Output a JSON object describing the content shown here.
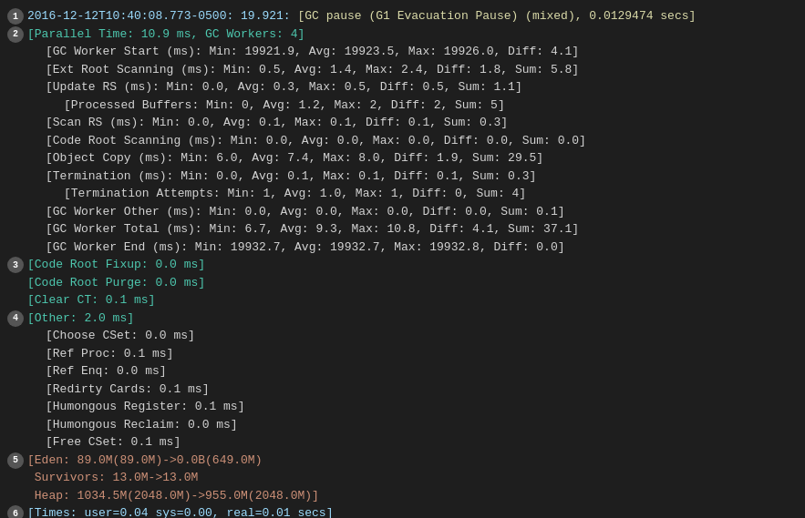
{
  "lines": [
    {
      "number": 1,
      "indent": 0,
      "parts": [
        {
          "text": "2016-12-12T10:40:08.773-0500: 19.921: ",
          "color": "c-cyan"
        },
        {
          "text": "[GC pause (G1 Evacuation Pause) (mixed), 0.0129474 secs]",
          "color": "c-yellow"
        }
      ]
    },
    {
      "number": 2,
      "indent": 0,
      "parts": [
        {
          "text": "[Parallel Time: 10.9 ms, GC Workers: 4]",
          "color": "c-green"
        }
      ]
    },
    {
      "number": null,
      "indent": 1,
      "parts": [
        {
          "text": "[GC Worker Start (ms): Min: 19921.9, Avg: 19923.5, Max: 19926.0, Diff: 4.1]",
          "color": "c-white"
        }
      ]
    },
    {
      "number": null,
      "indent": 1,
      "parts": [
        {
          "text": "[Ext Root Scanning (ms): Min: 0.5, Avg: 1.4, Max: 2.4, Diff: 1.8, Sum: 5.8]",
          "color": "c-white"
        }
      ]
    },
    {
      "number": null,
      "indent": 1,
      "parts": [
        {
          "text": "[Update RS (ms): Min: 0.0, Avg: 0.3, Max: 0.5, Diff: 0.5, Sum: 1.1]",
          "color": "c-white"
        }
      ]
    },
    {
      "number": null,
      "indent": 2,
      "parts": [
        {
          "text": "[Processed Buffers: Min: 0, Avg: 1.2, Max: 2, Diff: 2, Sum: 5]",
          "color": "c-white"
        }
      ]
    },
    {
      "number": null,
      "indent": 1,
      "parts": [
        {
          "text": "[Scan RS (ms): Min: 0.0, Avg: 0.1, Max: 0.1, Diff: 0.1, Sum: 0.3]",
          "color": "c-white"
        }
      ]
    },
    {
      "number": null,
      "indent": 1,
      "parts": [
        {
          "text": "[Code Root Scanning (ms): Min: 0.0, Avg: 0.0, Max: 0.0, Diff: 0.0, Sum: 0.0]",
          "color": "c-white"
        }
      ]
    },
    {
      "number": null,
      "indent": 1,
      "parts": [
        {
          "text": "[Object Copy (ms): Min: 6.0, Avg: 7.4, Max: 8.0, Diff: 1.9, Sum: 29.5]",
          "color": "c-white"
        }
      ]
    },
    {
      "number": null,
      "indent": 1,
      "parts": [
        {
          "text": "[Termination (ms): Min: 0.0, Avg: 0.1, Max: 0.1, Diff: 0.1, Sum: 0.3]",
          "color": "c-white"
        }
      ]
    },
    {
      "number": null,
      "indent": 2,
      "parts": [
        {
          "text": "[Termination Attempts: Min: 1, Avg: 1.0, Max: 1, Diff: 0, Sum: 4]",
          "color": "c-white"
        }
      ]
    },
    {
      "number": null,
      "indent": 1,
      "parts": [
        {
          "text": "[GC Worker Other (ms): Min: 0.0, Avg: 0.0, Max: 0.0, Diff: 0.0, Sum: 0.1]",
          "color": "c-white"
        }
      ]
    },
    {
      "number": null,
      "indent": 1,
      "parts": [
        {
          "text": "[GC Worker Total (ms): Min: 6.7, Avg: 9.3, Max: 10.8, Diff: 4.1, Sum: 37.1]",
          "color": "c-white"
        }
      ]
    },
    {
      "number": null,
      "indent": 1,
      "parts": [
        {
          "text": "[GC Worker End (ms): Min: 19932.7, Avg: 19932.7, Max: 19932.8, Diff: 0.0]",
          "color": "c-white"
        }
      ]
    },
    {
      "number": 3,
      "indent": 0,
      "parts": [
        {
          "text": "[Code Root Fixup: 0.0 ms]",
          "color": "c-green"
        }
      ]
    },
    {
      "number": null,
      "indent": 0,
      "no_number": true,
      "parts": [
        {
          "text": "[Code Root Purge: 0.0 ms]",
          "color": "c-green"
        }
      ]
    },
    {
      "number": null,
      "indent": 0,
      "no_number": true,
      "parts": [
        {
          "text": "[Clear CT: 0.1 ms]",
          "color": "c-green"
        }
      ]
    },
    {
      "number": 4,
      "indent": 0,
      "parts": [
        {
          "text": "[Other: 2.0 ms]",
          "color": "c-green"
        }
      ]
    },
    {
      "number": null,
      "indent": 1,
      "parts": [
        {
          "text": "[Choose CSet: 0.0 ms]",
          "color": "c-white"
        }
      ]
    },
    {
      "number": null,
      "indent": 1,
      "parts": [
        {
          "text": "[Ref Proc: 0.1 ms]",
          "color": "c-white"
        }
      ]
    },
    {
      "number": null,
      "indent": 1,
      "parts": [
        {
          "text": "[Ref Enq: 0.0 ms]",
          "color": "c-white"
        }
      ]
    },
    {
      "number": null,
      "indent": 1,
      "parts": [
        {
          "text": "[Redirty Cards: 0.1 ms]",
          "color": "c-white"
        }
      ]
    },
    {
      "number": null,
      "indent": 1,
      "parts": [
        {
          "text": "[Humongous Register: 0.1 ms]",
          "color": "c-white"
        }
      ]
    },
    {
      "number": null,
      "indent": 1,
      "parts": [
        {
          "text": "[Humongous Reclaim: 0.0 ms]",
          "color": "c-white"
        }
      ]
    },
    {
      "number": null,
      "indent": 1,
      "parts": [
        {
          "text": "[Free CSet: 0.1 ms]",
          "color": "c-white"
        }
      ]
    },
    {
      "number": 5,
      "indent": 0,
      "parts": [
        {
          "text": "[Eden: 89.0M(89.0M)->0.0B(649.0M)",
          "color": "c-orange"
        }
      ]
    },
    {
      "number": null,
      "indent": 0,
      "no_number": true,
      "parts": [
        {
          "text": " Survivors: 13.0M->13.0M",
          "color": "c-orange"
        }
      ]
    },
    {
      "number": null,
      "indent": 0,
      "no_number": true,
      "parts": [
        {
          "text": " Heap: 1034.5M(2048.0M)->955.0M(2048.0M)]",
          "color": "c-orange"
        }
      ]
    },
    {
      "number": 6,
      "indent": 0,
      "parts": [
        {
          "text": "[Times: user=0.04 sys=0.00, real=0.01 secs]",
          "color": "c-cyan"
        }
      ]
    }
  ]
}
